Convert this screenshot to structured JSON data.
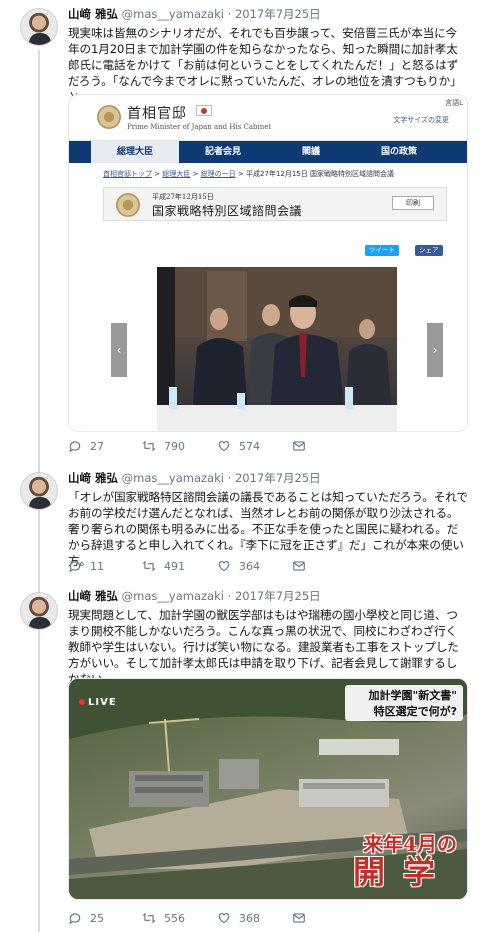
{
  "tweets": [
    {
      "name": "山﨑 雅弘",
      "handle": "@mas__yamazaki",
      "dot": "·",
      "date": "2017年7月25日",
      "text": "現実味は皆無のシナリオだが、それでも百歩譲って、安倍晋三氏が本当に今年の1月20日まで加計学園の件を知らなかったなら、知った瞬間に加計孝太郎氏に電話をかけて「お前は何ということをしてくれたんだ！」と怒るはずだろう。「なんで今までオレに黙っていたんだ、オレの地位を潰すつもりか」と。",
      "replies": "27",
      "retweets": "790",
      "likes": "574"
    },
    {
      "name": "山﨑 雅弘",
      "handle": "@mas__yamazaki",
      "dot": "·",
      "date": "2017年7月25日",
      "text": "「オレが国家戦略特区諮問会議の議長であることは知っていただろう。それでお前の学校だけ選んだとなれば、当然オレとお前の関係が取り沙汰される。奢り奢られの関係も明るみに出る。不正な手を使ったと国民に疑われる。だから辞退すると申し入れてくれ。『李下に冠を正さず』だ」これが本来の使い方。",
      "replies": "11",
      "retweets": "491",
      "likes": "364"
    },
    {
      "name": "山﨑 雅弘",
      "handle": "@mas__yamazaki",
      "dot": "·",
      "date": "2017年7月25日",
      "text": "現実問題として、加計学園の獣医学部はもはや瑞穂の國小學校と同じ道、つまり開校不能しかないだろう。こんな真っ黒の状況で、同校にわざわざ行く教師や学生はいない。行けば笑い物になる。建設業者も工事をストップした方がいい。そして加計孝太郎氏は申請を取り下げ、記者会見して謝罪するしかない。",
      "replies": "25",
      "retweets": "556",
      "likes": "368"
    }
  ],
  "kantei": {
    "site_title": "首相官邸",
    "site_subtitle": "Prime Minister of Japan and His Cabinet",
    "lang": "言語L",
    "font_size": "文字サイズの変更",
    "nav": [
      "総理大臣",
      "記者会見",
      "閣議",
      "国の政策"
    ],
    "breadcrumb_home": "首相官邸トップ",
    "breadcrumb_pm": "総理大臣",
    "breadcrumb_day": "総理の一日",
    "breadcrumb_current": "平成27年12月15日 国家戦略特別区域諮問会議",
    "sep": ">",
    "event_date": "平成27年12月15日",
    "event_title": "国家戦略特別区域諮問会議",
    "print": "印刷",
    "tweet_btn": "ツイート",
    "share_btn": "シェア",
    "prev": "‹",
    "next": "›"
  },
  "news": {
    "live": "LIVE",
    "caption_1": "加計学園\"新文書\"",
    "caption_2": "特区選定で何が?",
    "big_1": "来年4月の",
    "big_2": "開学"
  },
  "colors": {
    "thread_line": "#cfe3d6",
    "nav_blue": "#0d3a73",
    "overlay_red": "#c0302a"
  },
  "icons": [
    "reply-icon",
    "retweet-icon",
    "like-icon",
    "message-icon"
  ]
}
